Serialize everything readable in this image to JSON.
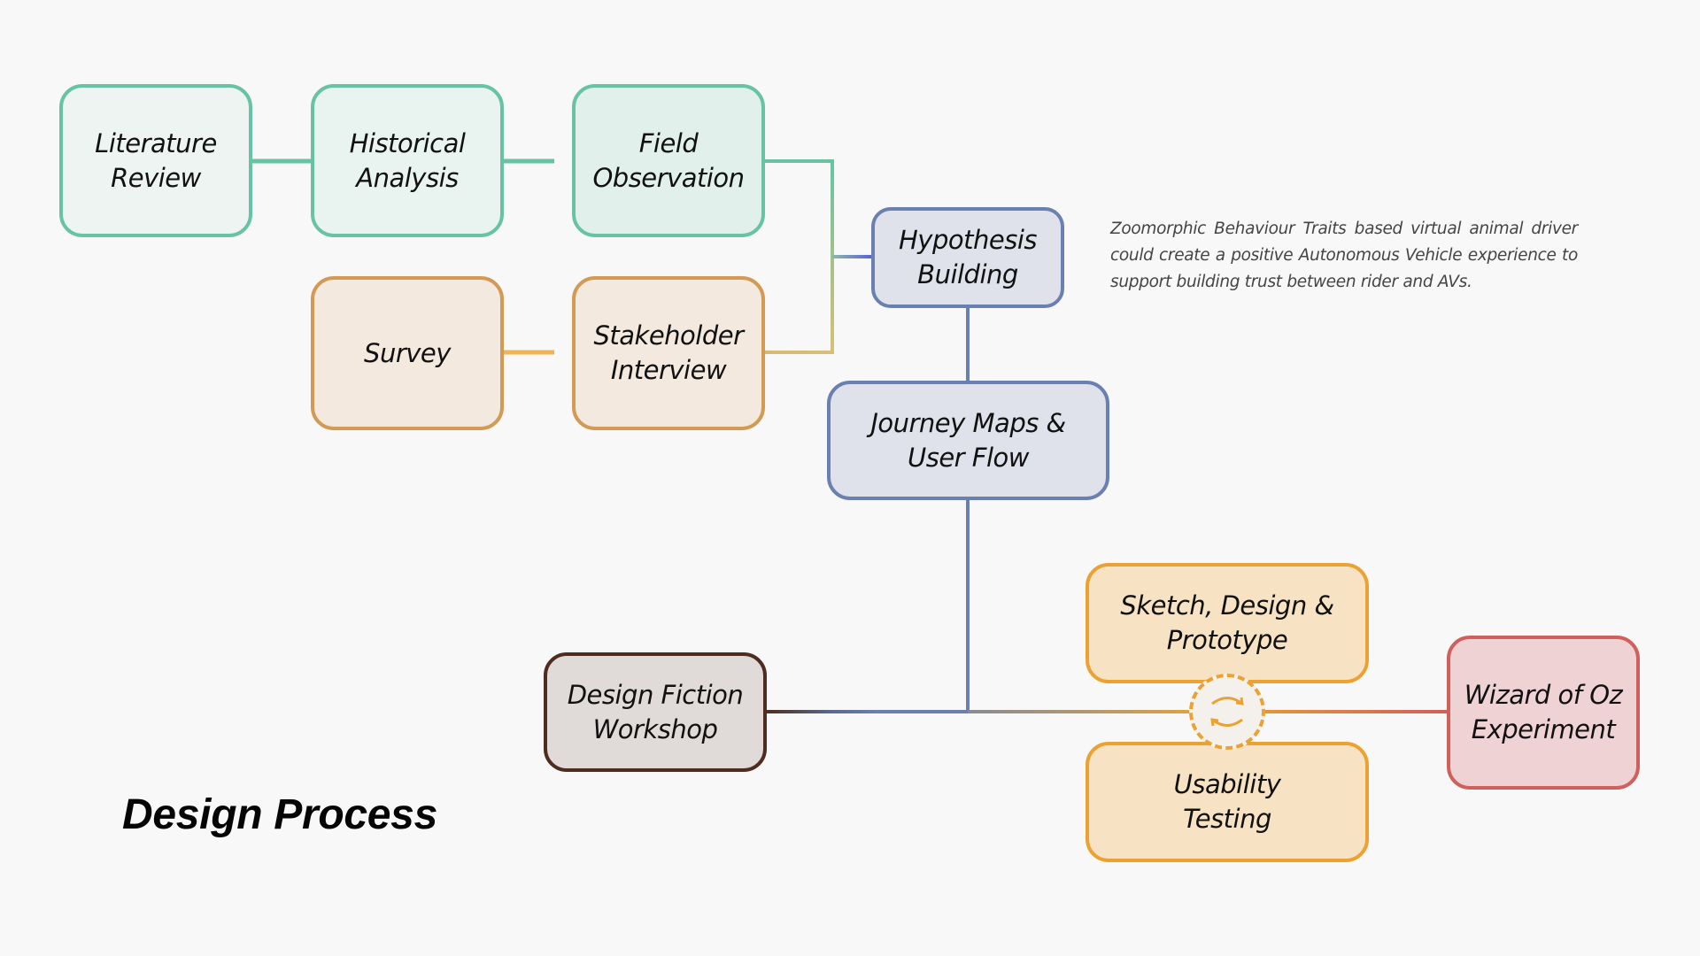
{
  "title": "Design Process",
  "note": "Zoomorphic Behaviour Traits based virtual animal driver could create a positive Autonomous Vehicle experience to support building trust between rider and AVs.",
  "colors": {
    "background": "#f8f8f8",
    "teal": "#67c3a2",
    "tan": "#d39a55",
    "survey_link": "#f0b454",
    "blue": "#6a80b0",
    "brown": "#4e2c1f",
    "amber": "#eba232",
    "red": "#cf605b"
  },
  "nodes": {
    "literature_review": "Literature\nReview",
    "historical_analysis": "Historical\nAnalysis",
    "field_observation": "Field\nObservation",
    "survey": "Survey",
    "stakeholder_interview": "Stakeholder\nInterview",
    "hypothesis_building": "Hypothesis\nBuilding",
    "journey_maps": "Journey Maps &\nUser Flow",
    "design_fiction": "Design Fiction\nWorkshop",
    "sketch_design": "Sketch, Design &\nPrototype",
    "usability_testing": "Usability\nTesting",
    "wizard_of_oz": "Wizard of Oz\nExperiment"
  },
  "cycle_icon": "iterate-cycle-icon",
  "edges": [
    [
      "literature_review",
      "historical_analysis"
    ],
    [
      "historical_analysis",
      "field_observation"
    ],
    [
      "survey",
      "stakeholder_interview"
    ],
    [
      "field_observation",
      "hypothesis_building"
    ],
    [
      "stakeholder_interview",
      "hypothesis_building"
    ],
    [
      "hypothesis_building",
      "journey_maps"
    ],
    [
      "journey_maps",
      "design_fiction"
    ],
    [
      "journey_maps",
      "sketch_design"
    ],
    [
      "journey_maps",
      "usability_testing"
    ],
    [
      "sketch_design",
      "usability_testing"
    ],
    [
      "usability_testing",
      "wizard_of_oz"
    ]
  ]
}
